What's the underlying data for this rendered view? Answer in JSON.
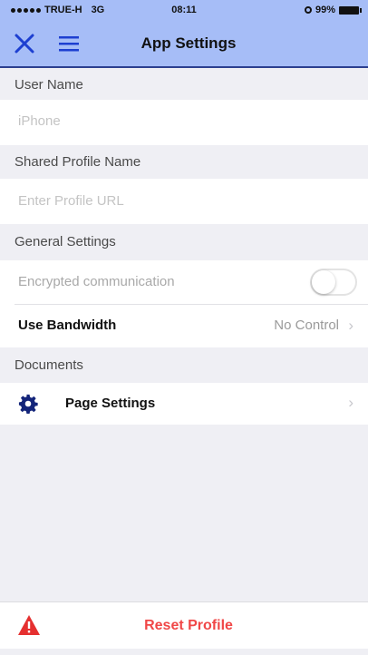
{
  "status_bar": {
    "carrier": "TRUE-H",
    "network": "3G",
    "time": "08:11",
    "battery": "99%"
  },
  "nav": {
    "title": "App Settings",
    "close_icon": "close-icon",
    "menu_icon": "hamburger-menu-icon"
  },
  "sections": {
    "user_name": {
      "header": "User Name",
      "placeholder": "iPhone"
    },
    "shared_profile": {
      "header": "Shared Profile Name",
      "placeholder": "Enter Profile URL"
    },
    "general": {
      "header": "General Settings",
      "encrypted_label": "Encrypted communication",
      "encrypted_on": false,
      "bandwidth_label": "Use Bandwidth",
      "bandwidth_value": "No Control"
    },
    "documents": {
      "header": "Documents",
      "page_settings_label": "Page Settings",
      "page_settings_icon": "gear-icon"
    }
  },
  "footer": {
    "reset_label": "Reset Profile",
    "reset_icon": "warning-icon"
  },
  "colors": {
    "nav_bg": "#a6bdf7",
    "accent_blue": "#1d3fd1",
    "danger": "#f04747",
    "gear": "#14257a"
  }
}
